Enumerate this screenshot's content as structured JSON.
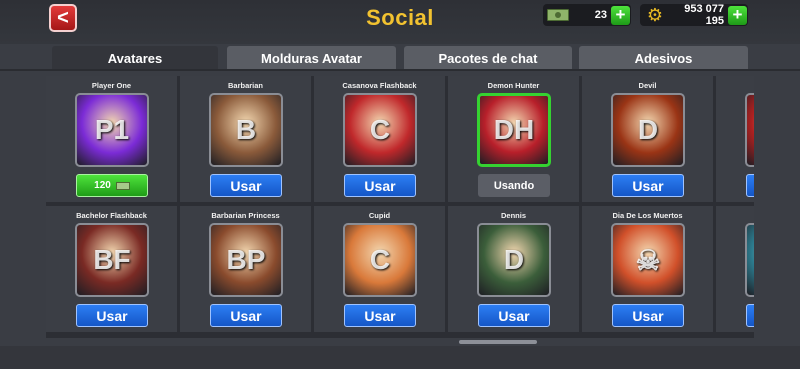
{
  "header": {
    "back_label": "<",
    "title": "Social",
    "cash": {
      "icon": "cash-icon",
      "value": "23"
    },
    "coins": {
      "icon": "coin-gear-icon",
      "value": "953 077 195"
    },
    "plus_label": "+"
  },
  "tabs": [
    {
      "label": "Avatares",
      "active": true
    },
    {
      "label": "Molduras Avatar",
      "active": false
    },
    {
      "label": "Pacotes de chat",
      "active": false
    },
    {
      "label": "Adesivos",
      "active": false
    }
  ],
  "avatars": [
    {
      "name": "Player One",
      "initial": "P1",
      "color": "#7b2bd6",
      "state": "buy",
      "button": "120"
    },
    {
      "name": "Barbarian",
      "initial": "B",
      "color": "#8a5a3a",
      "state": "use",
      "button": "Usar"
    },
    {
      "name": "Casanova Flashback",
      "initial": "C",
      "color": "#c0282b",
      "state": "use",
      "button": "Usar"
    },
    {
      "name": "Demon Hunter",
      "initial": "DH",
      "color": "#b81f2a",
      "state": "using",
      "button": "Usando"
    },
    {
      "name": "Devil",
      "initial": "D",
      "color": "#9a3415",
      "state": "use",
      "button": "Usar"
    },
    {
      "name": "",
      "initial": "",
      "color": "#b02020",
      "state": "use",
      "button": ""
    },
    {
      "name": "Bachelor Flashback",
      "initial": "BF",
      "color": "#7a2a24",
      "state": "use",
      "button": "Usar"
    },
    {
      "name": "Barbarian Princess",
      "initial": "BP",
      "color": "#8a4b2d",
      "state": "use",
      "button": "Usar"
    },
    {
      "name": "Cupid",
      "initial": "C",
      "color": "#d9793a",
      "state": "use",
      "button": "Usar"
    },
    {
      "name": "Dennis",
      "initial": "D",
      "color": "#3b5e3a",
      "state": "use",
      "button": "Usar"
    },
    {
      "name": "Dia De Los Muertos",
      "initial": "☠",
      "color": "#d1502a",
      "state": "use",
      "button": "Usar"
    },
    {
      "name": "",
      "initial": "",
      "color": "#2c7c8f",
      "state": "use",
      "button": ""
    }
  ]
}
